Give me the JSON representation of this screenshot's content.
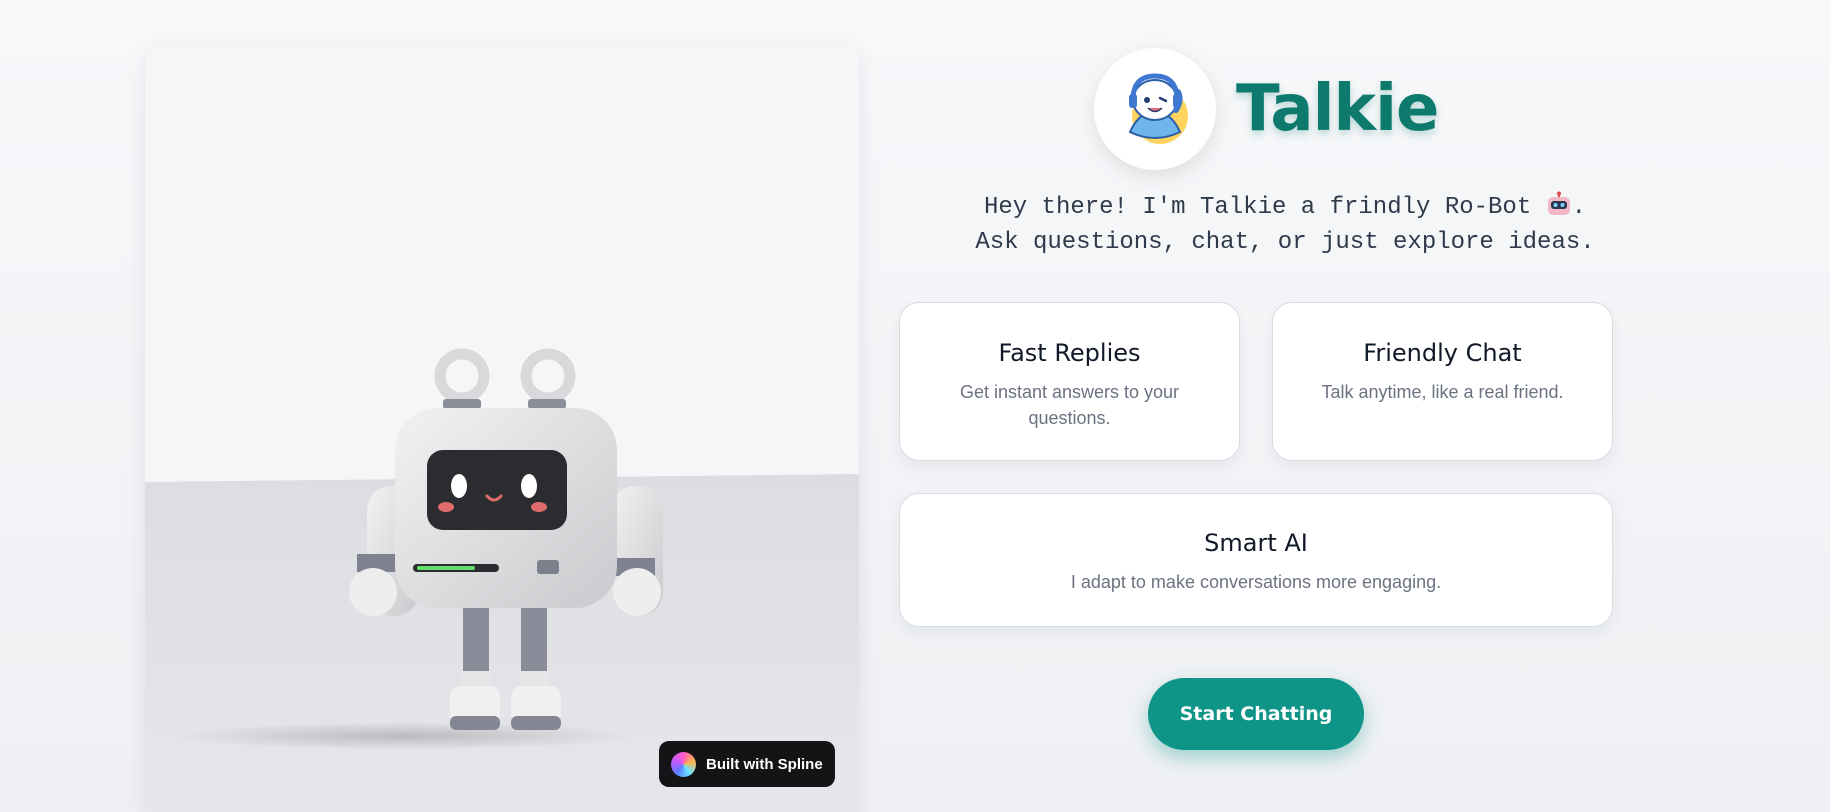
{
  "brand": {
    "name": "Talkie",
    "avatar_icon": "robot-headset-mascot-icon"
  },
  "tagline": {
    "line1_text": "Hey there! I'm Talkie a frindly Ro-Bot ",
    "line1_end": ".",
    "line1_emoji_icon": "robot-face-emoji-icon",
    "line2": "Ask questions, chat, or just explore ideas."
  },
  "features": [
    {
      "title": "Fast Replies",
      "description": "Get instant answers to your questions."
    },
    {
      "title": "Friendly Chat",
      "description": "Talk anytime, like a real friend."
    },
    {
      "title": "Smart AI",
      "description": "I adapt to make conversations more engaging."
    }
  ],
  "cta": {
    "label": "Start Chatting"
  },
  "scene": {
    "badge_label": "Built with Spline",
    "badge_icon": "spline-logo-icon"
  },
  "colors": {
    "brand_teal": "#0e7a6e",
    "button_teal": "#0f9488",
    "badge_dark": "#141416"
  }
}
